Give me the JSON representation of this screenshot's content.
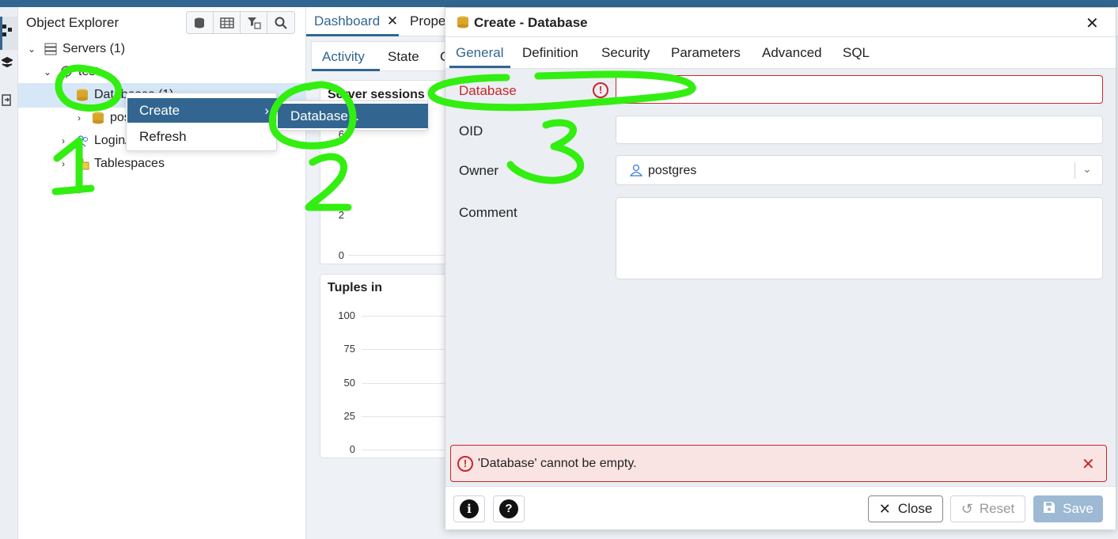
{
  "explorer": {
    "title": "Object Explorer",
    "tree": {
      "servers": "Servers (1)",
      "server_name": "test",
      "databases": "Databases (1)",
      "db_child": "postgres",
      "login": "Login/Group Roles",
      "tablespaces": "Tablespaces"
    }
  },
  "context_menu": {
    "create": "Create",
    "refresh": "Refresh",
    "submenu_database": "Database..."
  },
  "main": {
    "tabs": [
      "Dashboard",
      "Properties"
    ],
    "subtabs": [
      "Activity",
      "State",
      "Configuration"
    ],
    "panel1_title": "Server sessions",
    "panel1_ticks": [
      "6",
      "4",
      "2",
      "0"
    ],
    "panel2_title": "Tuples in",
    "panel2_ticks": [
      "100",
      "75",
      "50",
      "25",
      "0"
    ]
  },
  "dialog": {
    "title": "Create - Database",
    "tabs": [
      "General",
      "Definition",
      "Security",
      "Parameters",
      "Advanced",
      "SQL"
    ],
    "fields": {
      "database_label": "Database",
      "database_value": "",
      "oid_label": "OID",
      "oid_value": "",
      "owner_label": "Owner",
      "owner_value": "postgres",
      "comment_label": "Comment",
      "comment_value": ""
    },
    "error_message": "'Database' cannot be empty.",
    "buttons": {
      "close": "Close",
      "reset": "Reset",
      "save": "Save"
    }
  },
  "annotations": [
    "1",
    "2",
    "3"
  ],
  "colors": {
    "accent": "#326690",
    "error": "#c62828",
    "scribble": "#33ee11"
  }
}
